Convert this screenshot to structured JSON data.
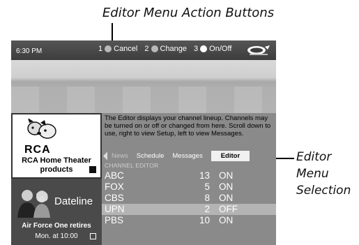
{
  "callouts": {
    "top": "Editor Menu Action Buttons",
    "right": [
      "Editor",
      "Menu",
      "Selection"
    ]
  },
  "screen": {
    "clock": "6:30 PM",
    "action_buttons": [
      {
        "number": "1",
        "label": "Cancel",
        "dot": "gray"
      },
      {
        "number": "2",
        "label": "Change",
        "dot": "gray"
      },
      {
        "number": "3",
        "label": "On/Off",
        "dot": "white"
      }
    ],
    "logo_icon": "guide-plus-logo",
    "ads": {
      "rca": {
        "brand": "RCA",
        "text_line1": "RCA Home Theater",
        "text_line2": "products"
      },
      "dateline": {
        "title": "Dateline",
        "line1": "Air Force One retires",
        "line2": "Mon. at 10:00"
      }
    },
    "description": "The Editor displays your channel lineup. Channels may be turned on or off or changed from here. Scroll down to use, right to view Setup, left to view Messages.",
    "tabs": [
      {
        "label": "News",
        "state": "dim"
      },
      {
        "label": "Schedule",
        "state": "normal"
      },
      {
        "label": "Messages",
        "state": "normal"
      },
      {
        "label": "Editor",
        "state": "active"
      }
    ],
    "editor_header": "CHANNEL EDITOR",
    "channels": [
      {
        "name": "ABC",
        "number": "13",
        "status": "ON"
      },
      {
        "name": "FOX",
        "number": "5",
        "status": "ON"
      },
      {
        "name": "CBS",
        "number": "8",
        "status": "ON"
      },
      {
        "name": "UPN",
        "number": "2",
        "status": "OFF",
        "selected": true
      },
      {
        "name": "PBS",
        "number": "10",
        "status": "ON"
      }
    ]
  }
}
